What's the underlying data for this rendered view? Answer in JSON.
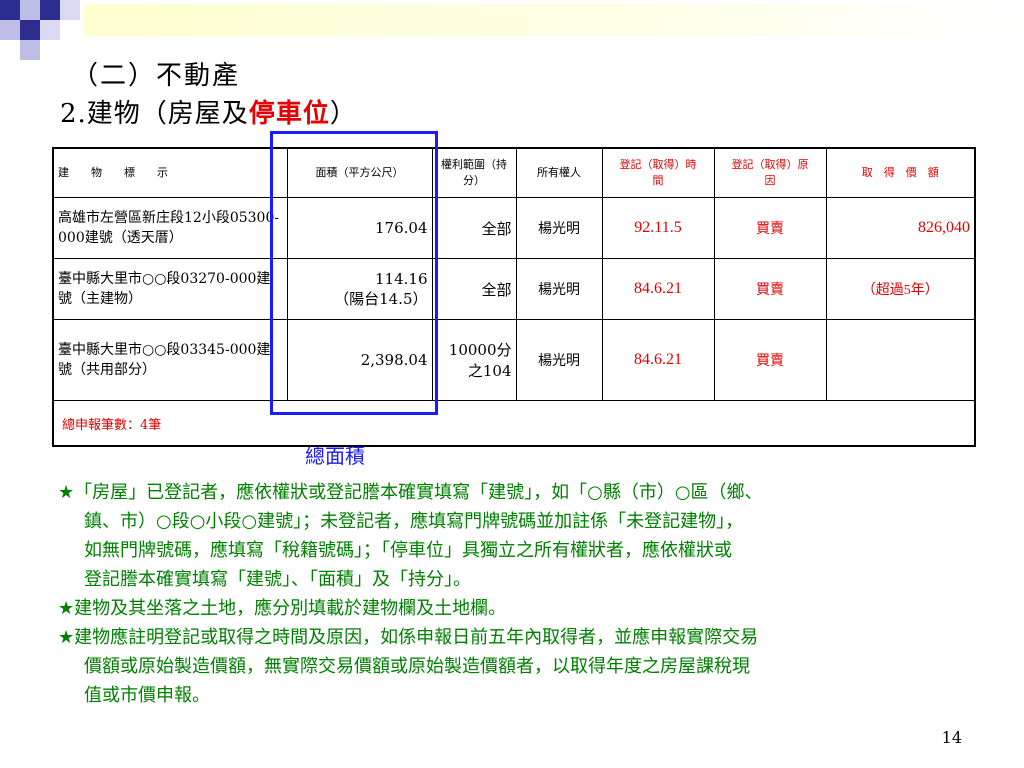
{
  "title_line1": "（二）不動產",
  "title_line2_prefix": "2.建物（房屋及",
  "title_line2_red": "停車位",
  "title_line2_suffix": "）",
  "table": {
    "headers": [
      "建　　物　　標　　示",
      "面積（平方公尺）",
      "權利範圍（持分）",
      "所有權人",
      "登記（取得）時　　間",
      "登記（取得）原　　因",
      "取　得　價　額"
    ],
    "rows": [
      {
        "label": "高雄市左營區新庄段12小段05300-000建號（透天厝）",
        "area": "176.04",
        "area_note": "",
        "share": "全部",
        "owner": "楊光明",
        "date": "92.11.5",
        "reason": "買賣",
        "price": "826,040"
      },
      {
        "label": "臺中縣大里市○○段03270-000建號（主建物）",
        "area": "114.16",
        "area_note": "（陽台14.5）",
        "share": "全部",
        "owner": "楊光明",
        "date": "84.6.21",
        "reason": "買賣",
        "price": "（超過5年）"
      },
      {
        "label": "臺中縣大里市○○段03345-000建號（共用部分）",
        "area": "2,398.04",
        "area_note": "",
        "share": "10000分之104",
        "owner": "楊光明",
        "date": "84.6.21",
        "reason": "買賣",
        "price": ""
      }
    ],
    "total": "總申報筆數：4筆"
  },
  "annotation_label": "總面積",
  "notes": [
    "★「房屋」已登記者，應依權狀或登記謄本確實填寫「建號」，如「○縣（市）○區（鄉、",
    "鎮、市）○段○小段○建號」；未登記者，應填寫門牌號碼並加註係「未登記建物」，",
    "如無門牌號碼，應填寫「稅籍號碼」；「停車位」具獨立之所有權狀者，應依權狀或",
    "登記謄本確實填寫「建號」、「面積」及「持分」。",
    "★建物及其坐落之土地，應分別填載於建物欄及土地欄。",
    "★建物應註明登記或取得之時間及原因，如係申報日前五年內取得者，並應申報實際交易",
    "價額或原始製造價額，無實際交易價額或原始製造價額者，以取得年度之房屋課稅現",
    "值或市價申報。"
  ],
  "page_number": "14",
  "colors": {
    "red": "#e60000",
    "green": "#008000",
    "blue": "#1a1aff"
  }
}
